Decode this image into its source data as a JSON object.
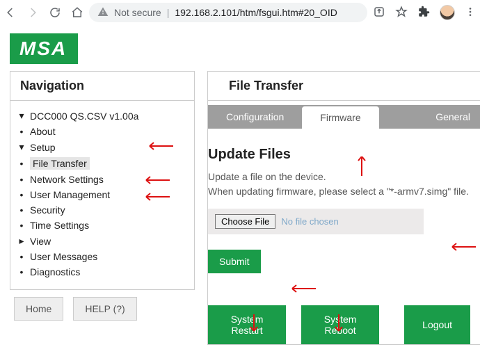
{
  "browser": {
    "not_secure": "Not secure",
    "url": "192.168.2.101/htm/fsgui.htm#20_OID"
  },
  "logo": "MSA",
  "nav": {
    "title": "Navigation",
    "root": "DCC000 QS.CSV v1.00a",
    "about": "About",
    "setup": "Setup",
    "file_transfer": "File Transfer",
    "network": "Network Settings",
    "user_mgmt": "User Management",
    "security": "Security",
    "time": "Time Settings",
    "view": "View",
    "user_msgs": "User Messages",
    "diag": "Diagnostics",
    "home_btn": "Home",
    "help_btn": "HELP (?)"
  },
  "right": {
    "title": "File Transfer",
    "tab_config": "Configuration",
    "tab_firmware": "Firmware",
    "tab_general": "General",
    "update_hdr": "Update Files",
    "line1": "Update a file on the device.",
    "line2": "When updating firmware, please select a \"*-armv7.simg\" file.",
    "choose": "Choose File",
    "nofile": "No file chosen",
    "submit": "Submit",
    "restart": "System Restart",
    "reboot": "System Reboot",
    "logout": "Logout"
  }
}
